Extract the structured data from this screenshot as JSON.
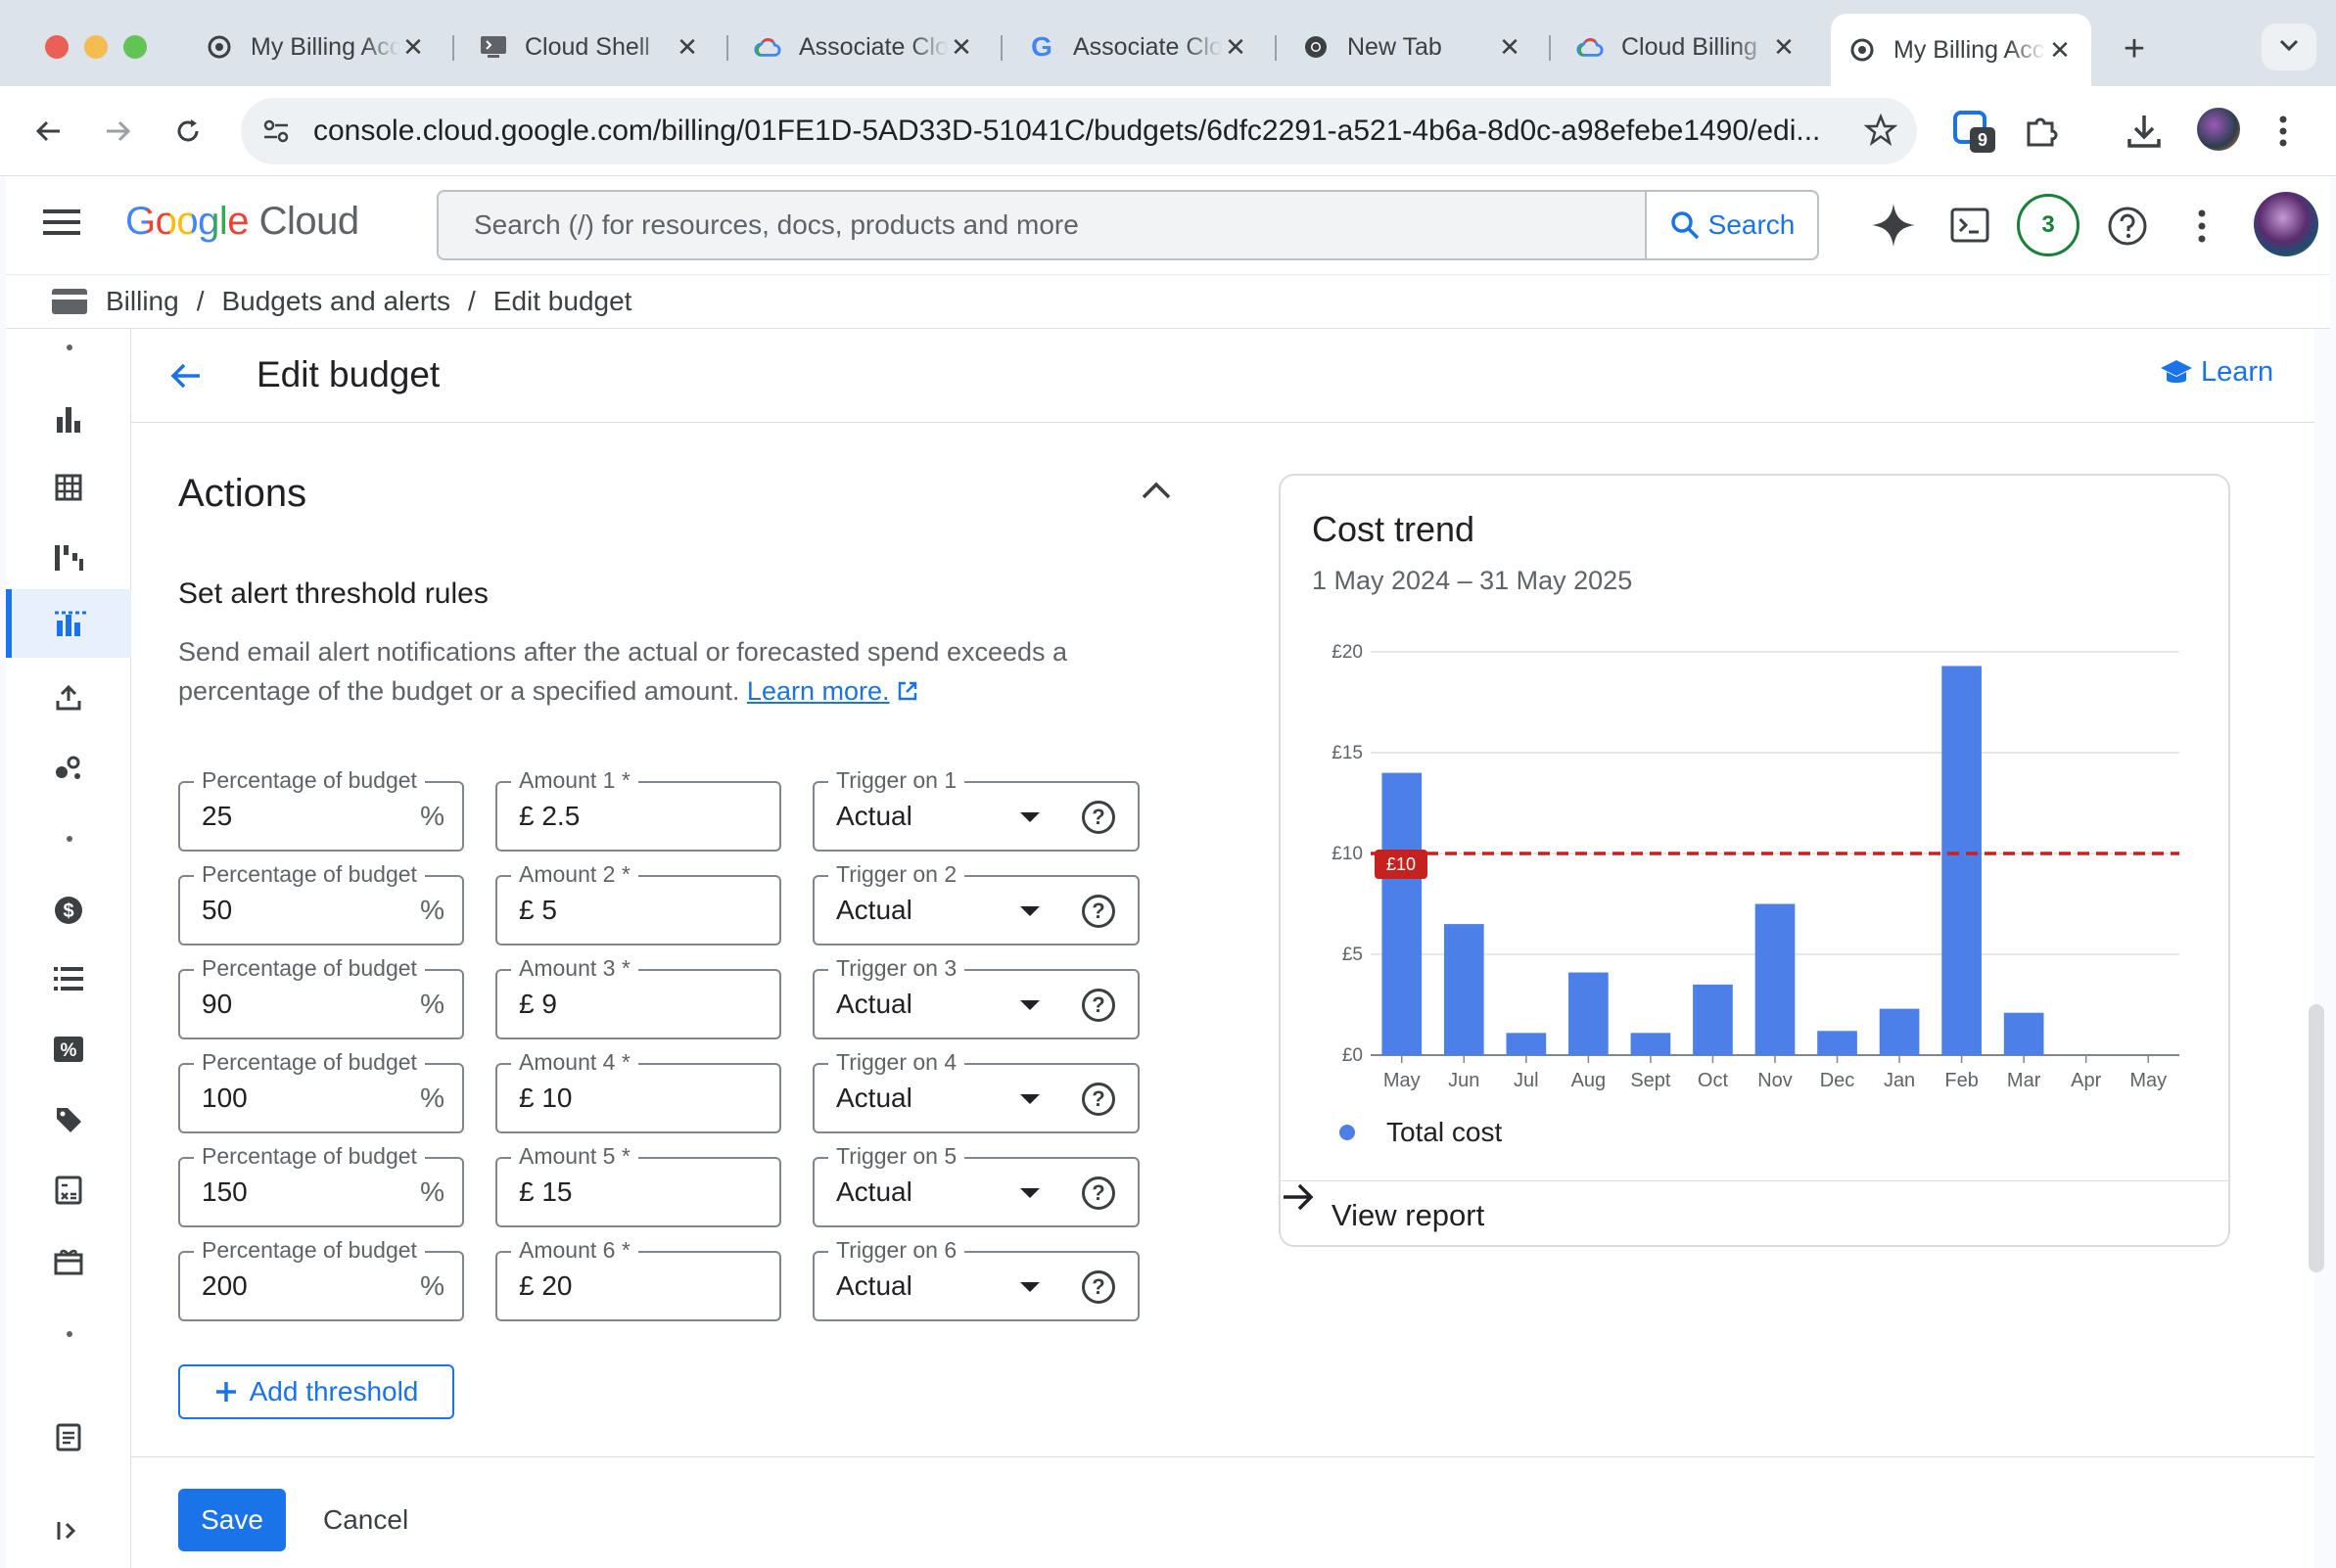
{
  "browser": {
    "tabs": [
      {
        "title": "My Billing Account",
        "icon": "gcp-billing-icon",
        "active": false
      },
      {
        "title": "Cloud Shell",
        "icon": "cloud-shell-icon",
        "active": false
      },
      {
        "title": "Associate Cloud Engineer",
        "icon": "google-cloud-icon",
        "active": false
      },
      {
        "title": "Associate Cloud Engineer",
        "icon": "google-icon",
        "active": false
      },
      {
        "title": "New Tab",
        "icon": "chrome-icon",
        "active": false
      },
      {
        "title": "Cloud Billing",
        "icon": "google-cloud-icon",
        "active": false
      },
      {
        "title": "My Billing Account",
        "icon": "gcp-billing-icon",
        "active": true
      }
    ],
    "close_glyph": "✕",
    "new_tab_glyph": "+",
    "url": "console.cloud.google.com/billing/01FE1D-5AD33D-51041C/budgets/6dfc2291-a521-4b6a-8d0c-a98efebe1490/edi...",
    "extension_badge": "9"
  },
  "header": {
    "logo_google": "Google",
    "logo_cloud": "Cloud",
    "search_placeholder": "Search (/) for resources, docs, products and more",
    "search_button": "Search",
    "notifications_count": "3"
  },
  "breadcrumb": {
    "items": [
      "Billing",
      "Budgets and alerts",
      "Edit budget"
    ],
    "separator": "/"
  },
  "page": {
    "title": "Edit budget",
    "learn_label": "Learn",
    "section_title": "Actions",
    "subsection_title": "Set alert threshold rules",
    "description": "Send email alert notifications after the actual or forecasted spend exceeds a percentage of the budget or a specified amount.",
    "learn_more": "Learn more.",
    "thresholds": [
      {
        "pct_label": "Percentage of budget",
        "pct": "25",
        "amt_label": "Amount 1 *",
        "amt": "2.5",
        "trig_label": "Trigger on 1",
        "trig": "Actual"
      },
      {
        "pct_label": "Percentage of budget",
        "pct": "50",
        "amt_label": "Amount 2 *",
        "amt": "5",
        "trig_label": "Trigger on 2",
        "trig": "Actual"
      },
      {
        "pct_label": "Percentage of budget",
        "pct": "90",
        "amt_label": "Amount 3 *",
        "amt": "9",
        "trig_label": "Trigger on 3",
        "trig": "Actual"
      },
      {
        "pct_label": "Percentage of budget",
        "pct": "100",
        "amt_label": "Amount 4 *",
        "amt": "10",
        "trig_label": "Trigger on 4",
        "trig": "Actual"
      },
      {
        "pct_label": "Percentage of budget",
        "pct": "150",
        "amt_label": "Amount 5 *",
        "amt": "15",
        "trig_label": "Trigger on 5",
        "trig": "Actual"
      },
      {
        "pct_label": "Percentage of budget",
        "pct": "200",
        "amt_label": "Amount 6 *",
        "amt": "20",
        "trig_label": "Trigger on 6",
        "trig": "Actual"
      }
    ],
    "percent_suffix": "%",
    "currency_prefix": "£",
    "add_threshold": "Add threshold",
    "save": "Save",
    "cancel": "Cancel"
  },
  "card": {
    "title": "Cost trend",
    "range": "1 May 2024 – 31 May 2025",
    "view_report": "View report"
  },
  "chart_data": {
    "type": "bar",
    "title": "Cost trend",
    "subtitle": "1 May 2024 – 31 May 2025",
    "categories": [
      "May",
      "Jun",
      "Jul",
      "Aug",
      "Sept",
      "Oct",
      "Nov",
      "Dec",
      "Jan",
      "Feb",
      "Mar",
      "Apr",
      "May"
    ],
    "series": [
      {
        "name": "Total cost",
        "values": [
          14.0,
          6.5,
          1.1,
          4.1,
          1.1,
          3.5,
          7.5,
          1.2,
          2.3,
          19.3,
          2.1,
          0,
          0
        ]
      }
    ],
    "y_ticks": [
      "£0",
      "£5",
      "£10",
      "£15",
      "£20"
    ],
    "ylim": [
      0,
      20
    ],
    "budget_line": {
      "value": 10,
      "label": "£10",
      "color": "#c5221f"
    },
    "bar_color": "#4c80e8",
    "grid": true,
    "legend_position": "bottom-left"
  },
  "colors": {
    "accent": "#1a73e8",
    "budget_line": "#c5221f",
    "bar": "#4c80e8"
  }
}
